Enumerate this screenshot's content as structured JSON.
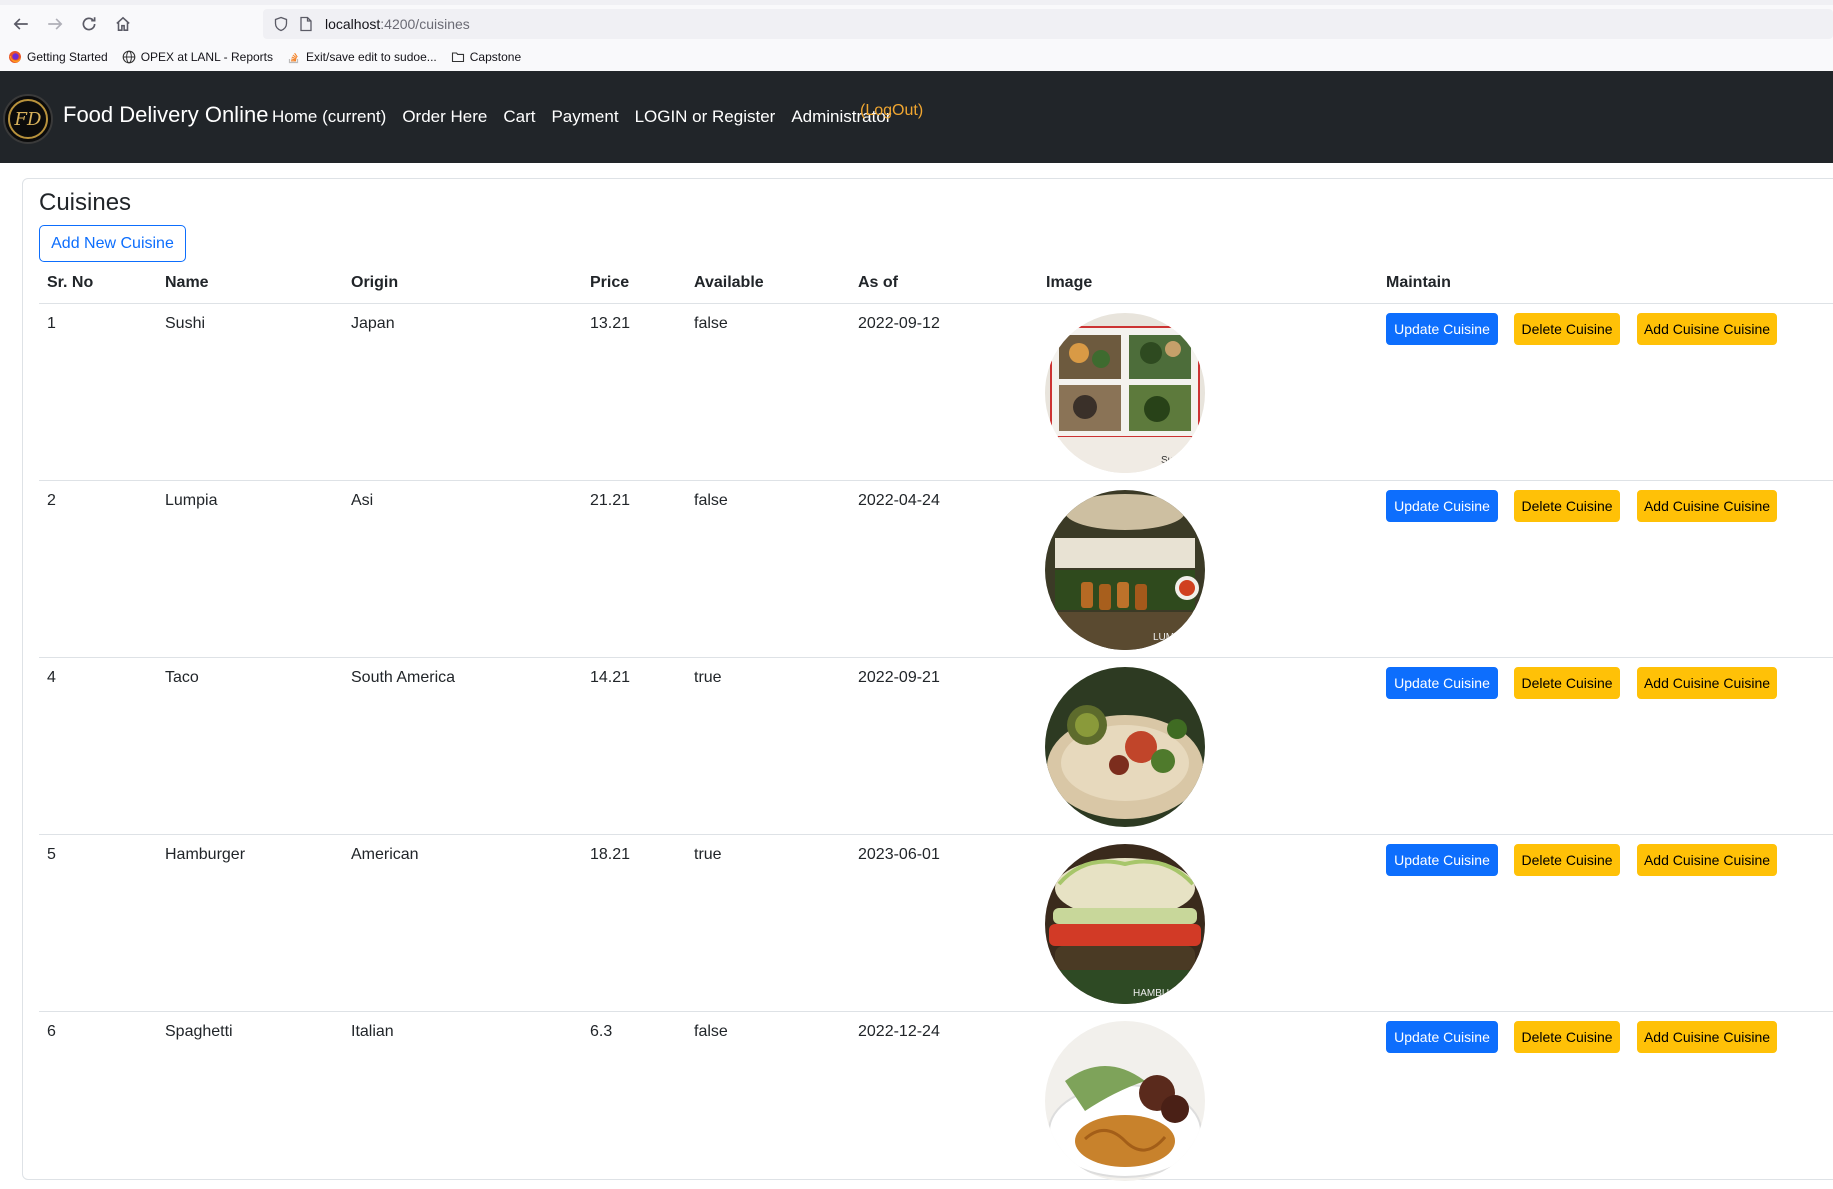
{
  "browser": {
    "url_host": "localhost",
    "url_rest": ":4200/cuisines",
    "bookmarks": [
      {
        "label": "Getting Started",
        "icon": "firefox-icon"
      },
      {
        "label": "OPEX at LANL - Reports",
        "icon": "globe-icon"
      },
      {
        "label": "Exit/save edit to sudoe...",
        "icon": "stackoverflow-icon"
      },
      {
        "label": "Capstone",
        "icon": "folder-icon"
      }
    ]
  },
  "navbar": {
    "logo_text": "FD",
    "brand": "Food Delivery Online",
    "links": [
      "Home (current)",
      "Order Here",
      "Cart",
      "Payment",
      "LOGIN or Register",
      "Administrator"
    ],
    "logout": "(LogOut)"
  },
  "page": {
    "title": "Cuisines",
    "add_button": "Add New Cuisine"
  },
  "table": {
    "headers": {
      "srno": "Sr. No",
      "name": "Name",
      "origin": "Origin",
      "price": "Price",
      "available": "Available",
      "asof": "As of",
      "image": "Image",
      "maintain": "Maintain"
    },
    "actions": {
      "update": "Update Cuisine",
      "delete": "Delete Cuisine",
      "add": "Add Cuisine Cuisine"
    },
    "rows": [
      {
        "srno": "1",
        "name": "Sushi",
        "origin": "Japan",
        "price": "13.21",
        "available": "false",
        "asof": "2022-09-12",
        "image_caption": "Su"
      },
      {
        "srno": "2",
        "name": "Lumpia",
        "origin": "Asi",
        "price": "21.21",
        "available": "false",
        "asof": "2022-04-24",
        "image_caption": "LUM"
      },
      {
        "srno": "4",
        "name": "Taco",
        "origin": "South America",
        "price": "14.21",
        "available": "true",
        "asof": "2022-09-21",
        "image_caption": ""
      },
      {
        "srno": "5",
        "name": "Hamburger",
        "origin": "American",
        "price": "18.21",
        "available": "true",
        "asof": "2023-06-01",
        "image_caption": "HAMBU"
      },
      {
        "srno": "6",
        "name": "Spaghetti",
        "origin": "Italian",
        "price": "6.3",
        "available": "false",
        "asof": "2022-12-24",
        "image_caption": ""
      }
    ]
  },
  "colors": {
    "navbar_bg": "#212529",
    "primary": "#0d6efd",
    "warning": "#ffc107",
    "logout": "#f0a630"
  }
}
